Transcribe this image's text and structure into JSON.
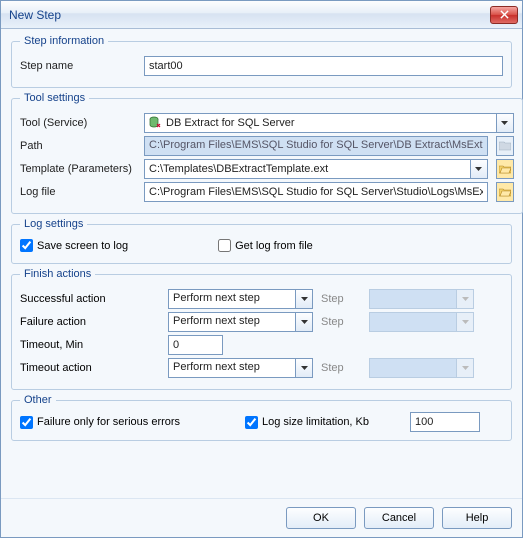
{
  "window": {
    "title": "New Step"
  },
  "step_info": {
    "legend": "Step information",
    "name_label": "Step name",
    "name_value": "start00"
  },
  "tool": {
    "legend": "Tool settings",
    "tool_label": "Tool (Service)",
    "tool_value": "DB Extract for SQL Server",
    "path_label": "Path",
    "path_value": "C:\\Program Files\\EMS\\SQL Studio for SQL Server\\DB Extract\\MsExt",
    "template_label": "Template (Parameters)",
    "template_value": "C:\\Templates\\DBExtractTemplate.ext",
    "log_label": "Log file",
    "log_value": "C:\\Program Files\\EMS\\SQL Studio for SQL Server\\Studio\\Logs\\MsEx"
  },
  "log": {
    "legend": "Log settings",
    "save_screen": "Save screen to log",
    "get_log": "Get log from file"
  },
  "finish": {
    "legend": "Finish actions",
    "success_label": "Successful action",
    "success_value": "Perform next step",
    "failure_label": "Failure action",
    "failure_value": "Perform next step",
    "timeout_label": "Timeout, Min",
    "timeout_value": "0",
    "timeout_action_label": "Timeout action",
    "timeout_action_value": "Perform next step",
    "step_label": "Step"
  },
  "other": {
    "legend": "Other",
    "failure_serious": "Failure only for serious errors",
    "log_limit": "Log size limitation, Kb",
    "log_limit_value": "100"
  },
  "buttons": {
    "ok": "OK",
    "cancel": "Cancel",
    "help": "Help"
  }
}
